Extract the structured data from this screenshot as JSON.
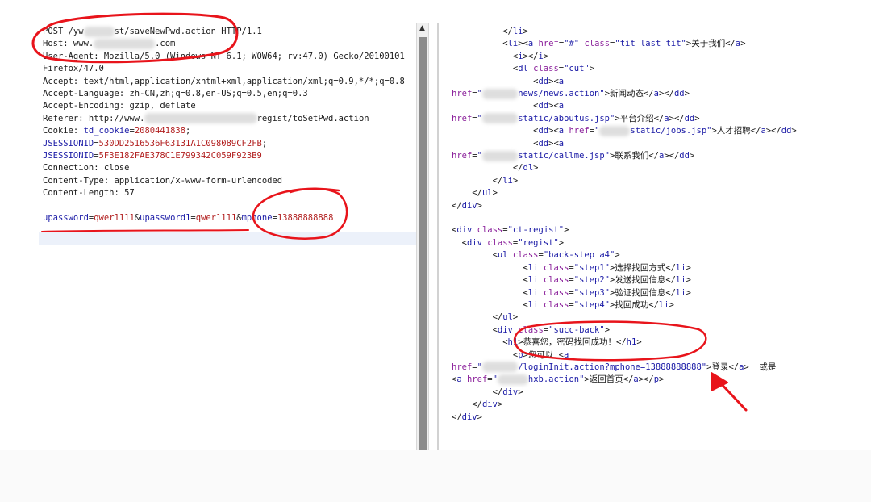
{
  "request_lines": [
    [
      {
        "t": "POST /yw"
      },
      {
        "b": "xxxxxx"
      },
      {
        "t": "st/saveNewPwd.action HTTP/1.1"
      }
    ],
    [
      {
        "t": "Host: www."
      },
      {
        "b": "xxxxxxxxxxxx"
      },
      {
        "t": ".com"
      }
    ],
    [
      {
        "t": "User-Agent: Mozilla/5.0 (Windows NT 6.1; WOW64; rv:47.0) Gecko/20100101"
      }
    ],
    [
      {
        "t": "Firefox/47.0"
      }
    ],
    [
      {
        "t": "Accept: text/html,application/xhtml+xml,application/xml;q=0.9,*/*;q=0.8"
      }
    ],
    [
      {
        "t": "Accept-Language: zh-CN,zh;q=0.8,en-US;q=0.5,en;q=0.3"
      }
    ],
    [
      {
        "t": "Accept-Encoding: gzip, deflate"
      }
    ],
    [
      {
        "t": "Referer: http://www."
      },
      {
        "b": "xxxxxxxxxxxxxxxxxxxxxx"
      },
      {
        "t": "regist/toSetPwd.action"
      }
    ],
    [
      {
        "t": "Cookie: "
      },
      {
        "k": "td_cookie"
      },
      {
        "t": "="
      },
      {
        "v": "2080441838"
      },
      {
        "t": ";"
      }
    ],
    [
      {
        "k": "JSESSIONID"
      },
      {
        "t": "="
      },
      {
        "v": "530DD2516536F63131A1C098089CF2FB"
      },
      {
        "t": ";"
      }
    ],
    [
      {
        "k": "JSESSIONID"
      },
      {
        "t": "="
      },
      {
        "v": "5F3E182FAE378C1E799342C059F923B9"
      }
    ],
    [
      {
        "t": "Connection: close"
      }
    ],
    [
      {
        "t": "Content-Type: application/x-www-form-urlencoded"
      }
    ],
    [
      {
        "t": "Content-Length: 57"
      }
    ],
    [
      {
        "t": ""
      }
    ],
    [
      {
        "k": "upassword"
      },
      {
        "t": "="
      },
      {
        "v": "qwer1111"
      },
      {
        "t": "&"
      },
      {
        "k": "upassword1"
      },
      {
        "t": "="
      },
      {
        "v": "qwer1111"
      },
      {
        "t": "&"
      },
      {
        "k": "mphone"
      },
      {
        "t": "="
      },
      {
        "v": "13888888888"
      }
    ]
  ],
  "response_lines": [
    [
      {
        "t": "          </"
      },
      {
        "g": "li"
      },
      {
        "t": ">"
      }
    ],
    [
      {
        "t": "          <"
      },
      {
        "g": "li"
      },
      {
        "t": "><"
      },
      {
        "g": "a"
      },
      {
        "t": " "
      },
      {
        "a": "href"
      },
      {
        "t": "="
      },
      {
        "s": "\"#\""
      },
      {
        "t": " "
      },
      {
        "a": "class"
      },
      {
        "t": "="
      },
      {
        "s": "\"tit last_tit\""
      },
      {
        "t": ">关于我们</"
      },
      {
        "g": "a"
      },
      {
        "t": ">"
      }
    ],
    [
      {
        "t": "            <"
      },
      {
        "g": "i"
      },
      {
        "t": "></"
      },
      {
        "g": "i"
      },
      {
        "t": ">"
      }
    ],
    [
      {
        "t": "            <"
      },
      {
        "g": "dl"
      },
      {
        "t": " "
      },
      {
        "a": "class"
      },
      {
        "t": "="
      },
      {
        "s": "\"cut\""
      },
      {
        "t": ">"
      }
    ],
    [
      {
        "t": "                <"
      },
      {
        "g": "dd"
      },
      {
        "t": "><"
      },
      {
        "g": "a"
      }
    ],
    [
      {
        "a": "href"
      },
      {
        "t": "="
      },
      {
        "s": "\""
      },
      {
        "b": "xxxxxxx"
      },
      {
        "s": "news/news.action\""
      },
      {
        "t": ">新闻动态</"
      },
      {
        "g": "a"
      },
      {
        "t": "></"
      },
      {
        "g": "dd"
      },
      {
        "t": ">"
      }
    ],
    [
      {
        "t": "                <"
      },
      {
        "g": "dd"
      },
      {
        "t": "><"
      },
      {
        "g": "a"
      }
    ],
    [
      {
        "a": "href"
      },
      {
        "t": "="
      },
      {
        "s": "\""
      },
      {
        "b": "xxxxxxx"
      },
      {
        "s": "static/aboutus.jsp\""
      },
      {
        "t": ">平台介绍</"
      },
      {
        "g": "a"
      },
      {
        "t": "></"
      },
      {
        "g": "dd"
      },
      {
        "t": ">"
      }
    ],
    [
      {
        "t": "                <"
      },
      {
        "g": "dd"
      },
      {
        "t": "><"
      },
      {
        "g": "a"
      },
      {
        "t": " "
      },
      {
        "a": "href"
      },
      {
        "t": "="
      },
      {
        "s": "\""
      },
      {
        "b": "xxxxxx"
      },
      {
        "s": "static/jobs.jsp\""
      },
      {
        "t": ">人才招聘</"
      },
      {
        "g": "a"
      },
      {
        "t": "></"
      },
      {
        "g": "dd"
      },
      {
        "t": ">"
      }
    ],
    [
      {
        "t": "                <"
      },
      {
        "g": "dd"
      },
      {
        "t": "><"
      },
      {
        "g": "a"
      }
    ],
    [
      {
        "a": "href"
      },
      {
        "t": "="
      },
      {
        "s": "\""
      },
      {
        "b": "xxxxxxx"
      },
      {
        "s": "static/callme.jsp\""
      },
      {
        "t": ">联系我们</"
      },
      {
        "g": "a"
      },
      {
        "t": "></"
      },
      {
        "g": "dd"
      },
      {
        "t": ">"
      }
    ],
    [
      {
        "t": "            </"
      },
      {
        "g": "dl"
      },
      {
        "t": ">"
      }
    ],
    [
      {
        "t": "        </"
      },
      {
        "g": "li"
      },
      {
        "t": ">"
      }
    ],
    [
      {
        "t": "    </"
      },
      {
        "g": "ul"
      },
      {
        "t": ">"
      }
    ],
    [
      {
        "t": "</"
      },
      {
        "g": "div"
      },
      {
        "t": ">"
      }
    ],
    [
      {
        "t": ""
      }
    ],
    [
      {
        "t": "<"
      },
      {
        "g": "div"
      },
      {
        "t": " "
      },
      {
        "a": "class"
      },
      {
        "t": "="
      },
      {
        "s": "\"ct-regist\""
      },
      {
        "t": ">"
      }
    ],
    [
      {
        "t": "  <"
      },
      {
        "g": "div"
      },
      {
        "t": " "
      },
      {
        "a": "class"
      },
      {
        "t": "="
      },
      {
        "s": "\"regist\""
      },
      {
        "t": ">"
      }
    ],
    [
      {
        "t": "        <"
      },
      {
        "g": "ul"
      },
      {
        "t": " "
      },
      {
        "a": "class"
      },
      {
        "t": "="
      },
      {
        "s": "\"back-step a4\""
      },
      {
        "t": ">"
      }
    ],
    [
      {
        "t": "              <"
      },
      {
        "g": "li"
      },
      {
        "t": " "
      },
      {
        "a": "class"
      },
      {
        "t": "="
      },
      {
        "s": "\"step1\""
      },
      {
        "t": ">选择找回方式</"
      },
      {
        "g": "li"
      },
      {
        "t": ">"
      }
    ],
    [
      {
        "t": "              <"
      },
      {
        "g": "li"
      },
      {
        "t": " "
      },
      {
        "a": "class"
      },
      {
        "t": "="
      },
      {
        "s": "\"step2\""
      },
      {
        "t": ">发送找回信息</"
      },
      {
        "g": "li"
      },
      {
        "t": ">"
      }
    ],
    [
      {
        "t": "              <"
      },
      {
        "g": "li"
      },
      {
        "t": " "
      },
      {
        "a": "class"
      },
      {
        "t": "="
      },
      {
        "s": "\"step3\""
      },
      {
        "t": ">验证找回信息</"
      },
      {
        "g": "li"
      },
      {
        "t": ">"
      }
    ],
    [
      {
        "t": "              <"
      },
      {
        "g": "li"
      },
      {
        "t": " "
      },
      {
        "a": "class"
      },
      {
        "t": "="
      },
      {
        "s": "\"step4\""
      },
      {
        "t": ">找回成功</"
      },
      {
        "g": "li"
      },
      {
        "t": ">"
      }
    ],
    [
      {
        "t": "        </"
      },
      {
        "g": "ul"
      },
      {
        "t": ">"
      }
    ],
    [
      {
        "t": "        <"
      },
      {
        "g": "div"
      },
      {
        "t": " "
      },
      {
        "a": "class"
      },
      {
        "t": "="
      },
      {
        "s": "\"succ-back\""
      },
      {
        "t": ">"
      }
    ],
    [
      {
        "t": "          <"
      },
      {
        "g": "h1"
      },
      {
        "t": ">恭喜您，密码找回成功！</"
      },
      {
        "g": "h1"
      },
      {
        "t": ">"
      }
    ],
    [
      {
        "t": "            <"
      },
      {
        "g": "p"
      },
      {
        "t": ">您可以 <"
      },
      {
        "g": "a"
      }
    ],
    [
      {
        "a": "href"
      },
      {
        "t": "="
      },
      {
        "s": "\""
      },
      {
        "b": "xxxxxxx"
      },
      {
        "s": "/loginInit.action?mphone=13888888888\""
      },
      {
        "t": ">登录</"
      },
      {
        "g": "a"
      },
      {
        "t": ">  或是"
      }
    ],
    [
      {
        "t": "<"
      },
      {
        "g": "a"
      },
      {
        "t": " "
      },
      {
        "a": "href"
      },
      {
        "t": "="
      },
      {
        "s": "\""
      },
      {
        "b": "xxxxxx"
      },
      {
        "s": "hxb.action\""
      },
      {
        "t": ">返回首页</"
      },
      {
        "g": "a"
      },
      {
        "t": "></"
      },
      {
        "g": "p"
      },
      {
        "t": ">"
      }
    ],
    [
      {
        "t": "        </"
      },
      {
        "g": "div"
      },
      {
        "t": ">"
      }
    ],
    [
      {
        "t": "    </"
      },
      {
        "g": "div"
      },
      {
        "t": ">"
      }
    ],
    [
      {
        "t": "</"
      },
      {
        "g": "div"
      },
      {
        "t": ">"
      }
    ]
  ],
  "colors": {
    "annotation": "#e8141b",
    "param_key": "#1a1aa6",
    "param_value": "#b22020",
    "attr_name": "#8a1f9a"
  }
}
